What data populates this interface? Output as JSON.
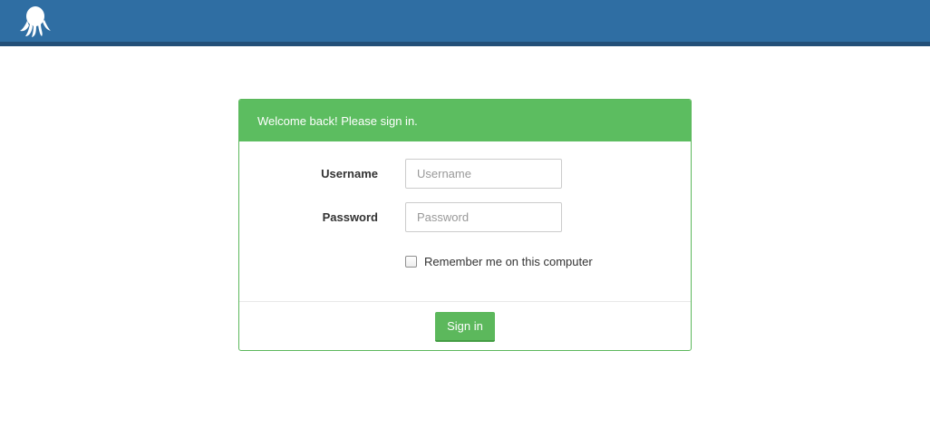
{
  "header": {
    "logo_icon": "octopus-logo-icon",
    "bar_color": "#2f6ea3"
  },
  "login": {
    "heading": "Welcome back! Please sign in.",
    "username_label": "Username",
    "username_placeholder": "Username",
    "username_value": "",
    "password_label": "Password",
    "password_placeholder": "Password",
    "password_value": "",
    "remember_label": "Remember me on this computer",
    "remember_checked": false,
    "signin_label": "Sign in",
    "accent_color": "#5cb85c"
  }
}
